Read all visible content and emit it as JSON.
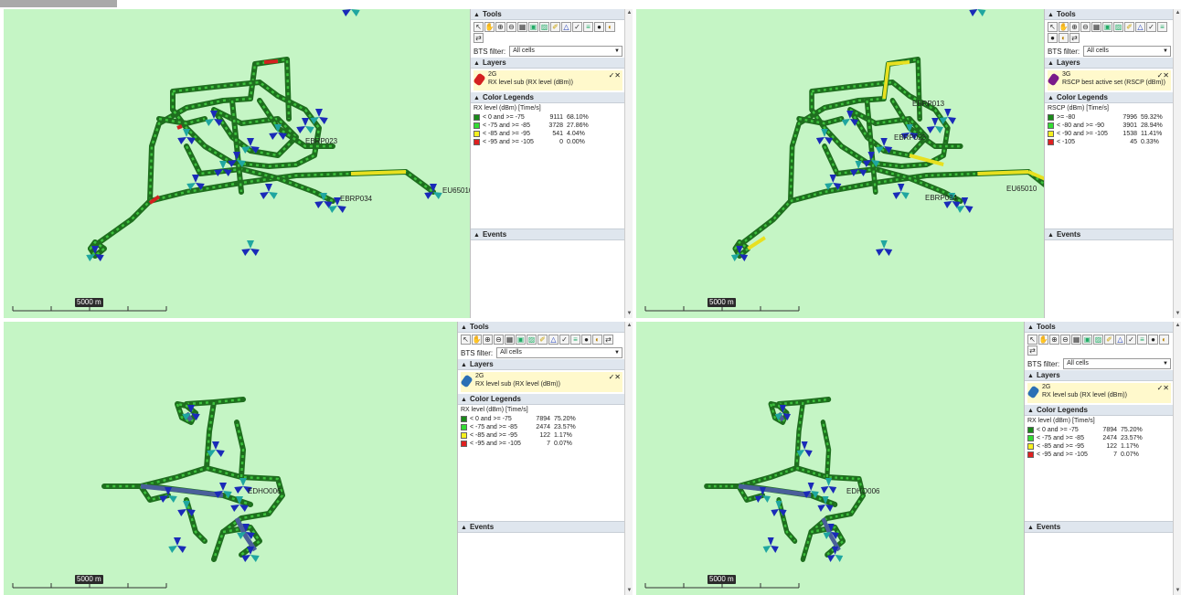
{
  "panels": [
    {
      "id": "top-left",
      "tools_title": "Tools",
      "bts_filter_label": "BTS filter:",
      "bts_filter_value": "All cells",
      "layers_title": "Layers",
      "layer_name": "2G",
      "layer_desc": "RX level sub (RX level (dBm))",
      "layer_color": "#d42020",
      "legends_title": "Color Legends",
      "legend_title": "RX level (dBm) [Time/s]",
      "legend": [
        {
          "label": "< 0 and >= -75",
          "count": "9111",
          "pct": "68.10%",
          "color": "#1a8a1a"
        },
        {
          "label": "< -75 and >= -85",
          "count": "3728",
          "pct": "27.86%",
          "color": "#33dd33"
        },
        {
          "label": "< -85 and >= -95",
          "count": "541",
          "pct": "4.04%",
          "color": "#f5f020"
        },
        {
          "label": "< -95 and >= -105",
          "count": "0",
          "pct": "0.00%",
          "color": "#e02020"
        }
      ],
      "events_title": "Events",
      "scale_label": "5000 m",
      "site_labels": [
        "EBRP023",
        "EBRP034",
        "EU65010"
      ]
    },
    {
      "id": "top-right",
      "tools_title": "Tools",
      "bts_filter_label": "BTS filter:",
      "bts_filter_value": "All cells",
      "layers_title": "Layers",
      "layer_name": "3G",
      "layer_desc": "RSCP best active set (RSCP (dBm))",
      "layer_color": "#7a1a8a",
      "legends_title": "Color Legends",
      "legend_title": "RSCP (dBm) [Time/s]",
      "legend": [
        {
          "label": ">= -80",
          "count": "7996",
          "pct": "59.32%",
          "color": "#1a8a1a"
        },
        {
          "label": "< -80 and >= -90",
          "count": "3901",
          "pct": "28.94%",
          "color": "#33dd33"
        },
        {
          "label": "< -90 and >= -105",
          "count": "1538",
          "pct": "11.41%",
          "color": "#f5f020"
        },
        {
          "label": "< -105",
          "count": "45",
          "pct": "0.33%",
          "color": "#e02020"
        }
      ],
      "events_title": "Events",
      "scale_label": "5000 m",
      "site_labels": [
        "EBRP013",
        "EBRP023",
        "EBRP034",
        "EU65010"
      ]
    },
    {
      "id": "bottom-left",
      "tools_title": "Tools",
      "bts_filter_label": "BTS filter:",
      "bts_filter_value": "All cells",
      "layers_title": "Layers",
      "layer_name": "2G",
      "layer_desc": "RX level sub (RX level (dBm))",
      "layer_color": "#2a6fb5",
      "legends_title": "Color Legends",
      "legend_title": "RX level (dBm) [Time/s]",
      "legend": [
        {
          "label": "< 0 and >= -75",
          "count": "7894",
          "pct": "75.20%",
          "color": "#1a8a1a"
        },
        {
          "label": "< -75 and >= -85",
          "count": "2474",
          "pct": "23.57%",
          "color": "#33dd33"
        },
        {
          "label": "< -85 and >= -95",
          "count": "122",
          "pct": "1.17%",
          "color": "#f5f020"
        },
        {
          "label": "< -95 and >= -105",
          "count": "7",
          "pct": "0.07%",
          "color": "#e02020"
        }
      ],
      "events_title": "Events",
      "scale_label": "5000 m",
      "site_labels": [
        "EDHO006"
      ]
    },
    {
      "id": "bottom-right",
      "tools_title": "Tools",
      "bts_filter_label": "BTS filter:",
      "bts_filter_value": "All cells",
      "layers_title": "Layers",
      "layer_name": "2G",
      "layer_desc": "RX level sub (RX level (dBm))",
      "layer_color": "#2a6fb5",
      "legends_title": "Color Legends",
      "legend_title": "RX level (dBm) [Time/s]",
      "legend": [
        {
          "label": "< 0 and >= -75",
          "count": "7894",
          "pct": "75.20%",
          "color": "#1a8a1a"
        },
        {
          "label": "< -75 and >= -85",
          "count": "2474",
          "pct": "23.57%",
          "color": "#33dd33"
        },
        {
          "label": "< -85 and >= -95",
          "count": "122",
          "pct": "1.17%",
          "color": "#f5f020"
        },
        {
          "label": "< -95 and >= -105",
          "count": "7",
          "pct": "0.07%",
          "color": "#e02020"
        }
      ],
      "events_title": "Events",
      "scale_label": "5000 m",
      "site_labels": [
        "EDHO006"
      ]
    }
  ],
  "tool_icons": [
    "pointer-icon",
    "hand-pan-icon",
    "zoom-in-icon",
    "zoom-out-icon",
    "grid-icon",
    "map-layer-icon",
    "map-layer-2-icon",
    "ruler-icon",
    "polygon-icon",
    "checkmark-icon",
    "route-icon",
    "globe-icon",
    "layers-icon",
    "export-icon"
  ]
}
